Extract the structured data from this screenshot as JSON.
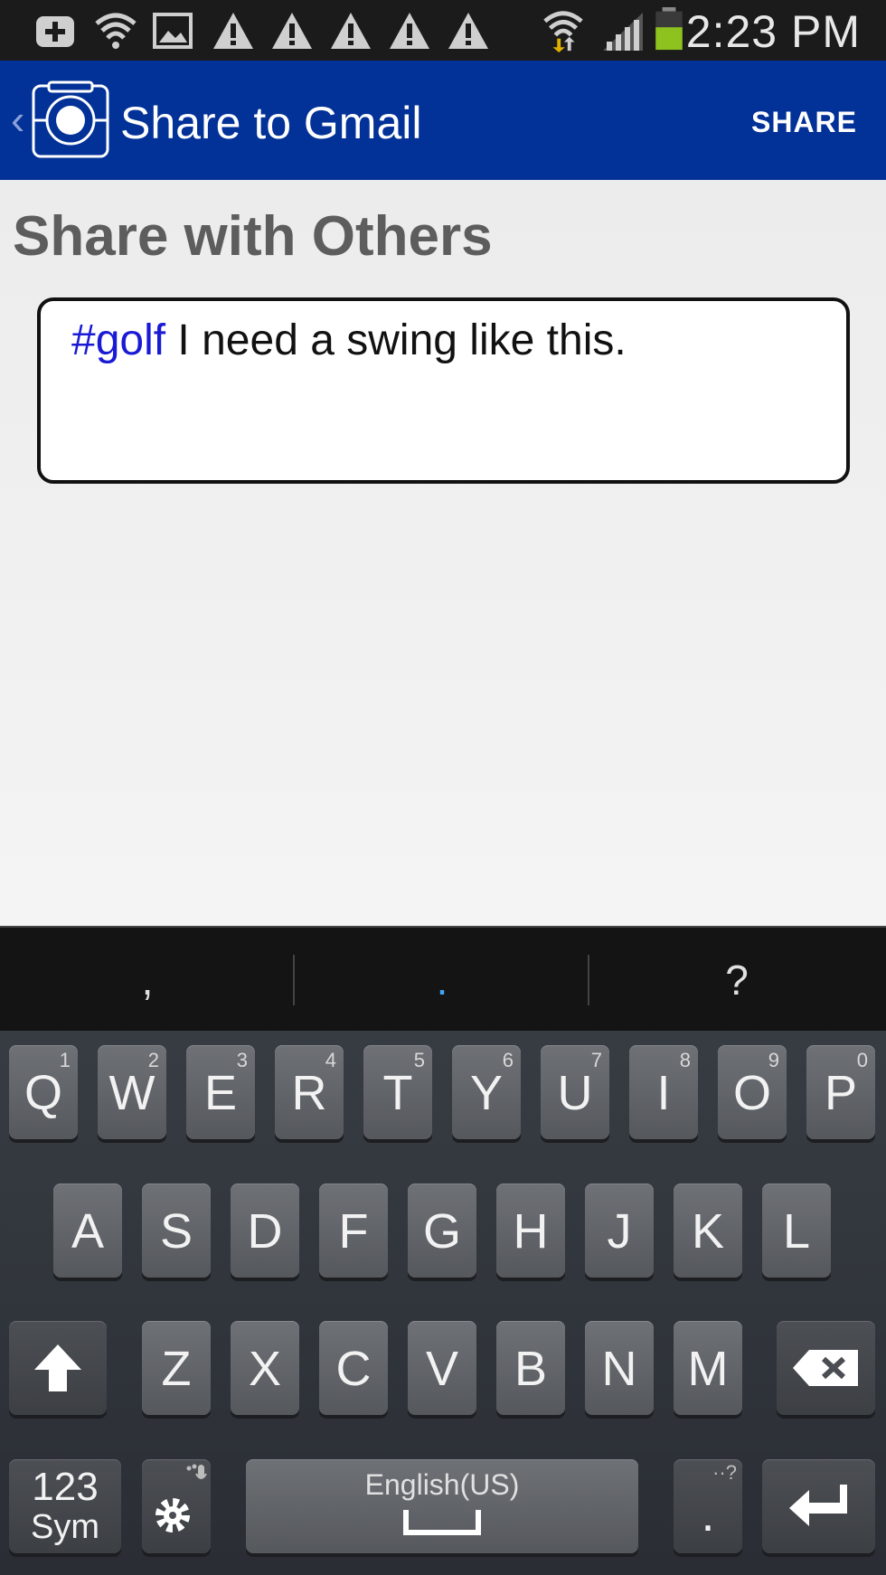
{
  "status_bar": {
    "time": "2:23 PM",
    "icons": [
      "add-box-icon",
      "wifi-help-icon",
      "image-icon",
      "warning-icon",
      "warning-icon",
      "warning-icon",
      "warning-icon",
      "warning-icon",
      "wifi-transfer-icon",
      "signal-icon",
      "battery-icon"
    ]
  },
  "action_bar": {
    "title": "Share to Gmail",
    "share_label": "SHARE"
  },
  "content": {
    "section_title": "Share with Others",
    "message_hashtag": "#golf",
    "message_text": " I need a swing like this."
  },
  "keyboard": {
    "suggestions": [
      ",",
      ".",
      "?"
    ],
    "row1": [
      {
        "key": "Q",
        "num": "1"
      },
      {
        "key": "W",
        "num": "2"
      },
      {
        "key": "E",
        "num": "3"
      },
      {
        "key": "R",
        "num": "4"
      },
      {
        "key": "T",
        "num": "5"
      },
      {
        "key": "Y",
        "num": "6"
      },
      {
        "key": "U",
        "num": "7"
      },
      {
        "key": "I",
        "num": "8"
      },
      {
        "key": "O",
        "num": "9"
      },
      {
        "key": "P",
        "num": "0"
      }
    ],
    "row2": [
      "A",
      "S",
      "D",
      "F",
      "G",
      "H",
      "J",
      "K",
      "L"
    ],
    "row3": [
      "Z",
      "X",
      "C",
      "V",
      "B",
      "N",
      "M"
    ],
    "sym_top": "123",
    "sym_bottom": "Sym",
    "space_label": "English(US)",
    "period": "."
  }
}
